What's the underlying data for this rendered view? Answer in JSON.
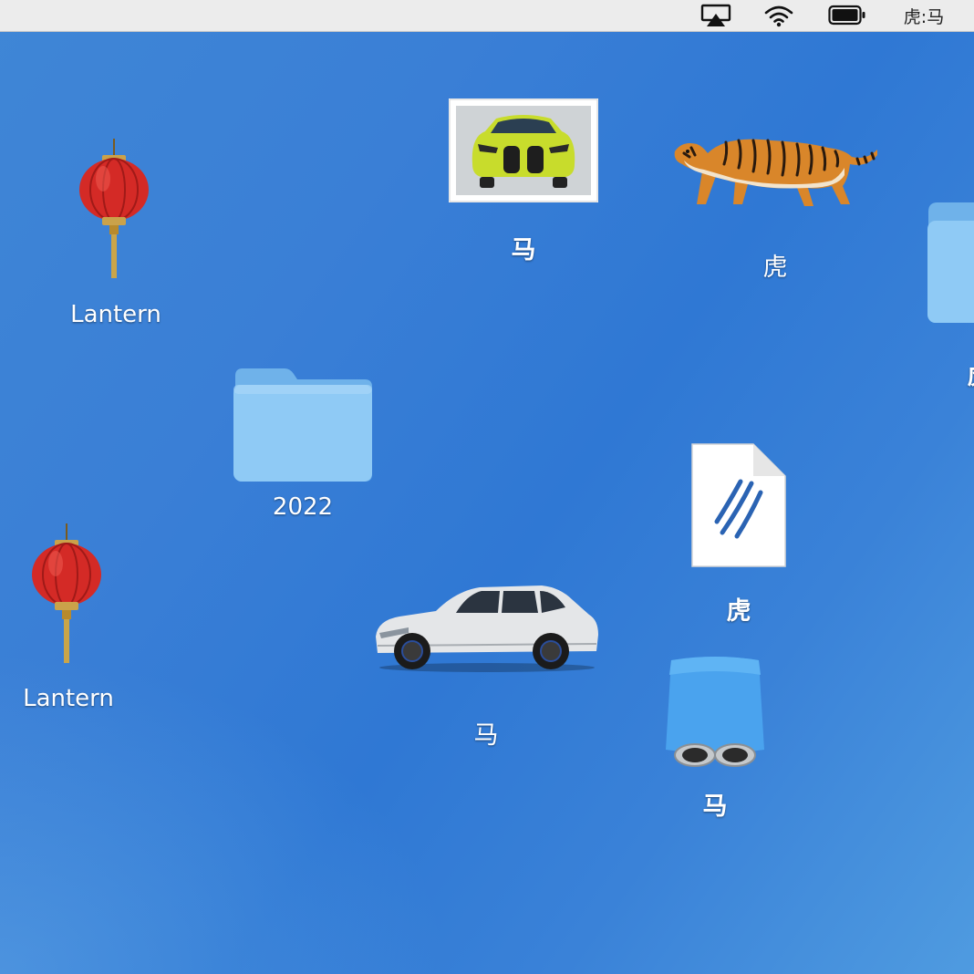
{
  "menubar": {
    "items": [
      {
        "id": "airplay",
        "icon": "airplay-icon"
      },
      {
        "id": "wifi",
        "icon": "wifi-icon"
      },
      {
        "id": "battery",
        "icon": "battery-icon"
      }
    ],
    "clock_text": "虎:马"
  },
  "desktop": {
    "icons": [
      {
        "kind": "lantern",
        "label": "Lantern"
      },
      {
        "kind": "lantern",
        "label": "Lantern"
      },
      {
        "kind": "folder",
        "label": "2022"
      },
      {
        "kind": "image-thumbnail-car",
        "label": "马"
      },
      {
        "kind": "tiger-image",
        "label": "虎"
      },
      {
        "kind": "document",
        "label": "虎"
      },
      {
        "kind": "suv-car",
        "label": "马"
      },
      {
        "kind": "exhaust-app",
        "label": "马"
      },
      {
        "kind": "folder-partial",
        "label": "虎"
      }
    ]
  },
  "colors": {
    "desktop_bg": "#3a7fd6",
    "menubar_bg": "#ececec",
    "folder_blue": "#8fcaf5",
    "lantern_red": "#d42a26"
  }
}
